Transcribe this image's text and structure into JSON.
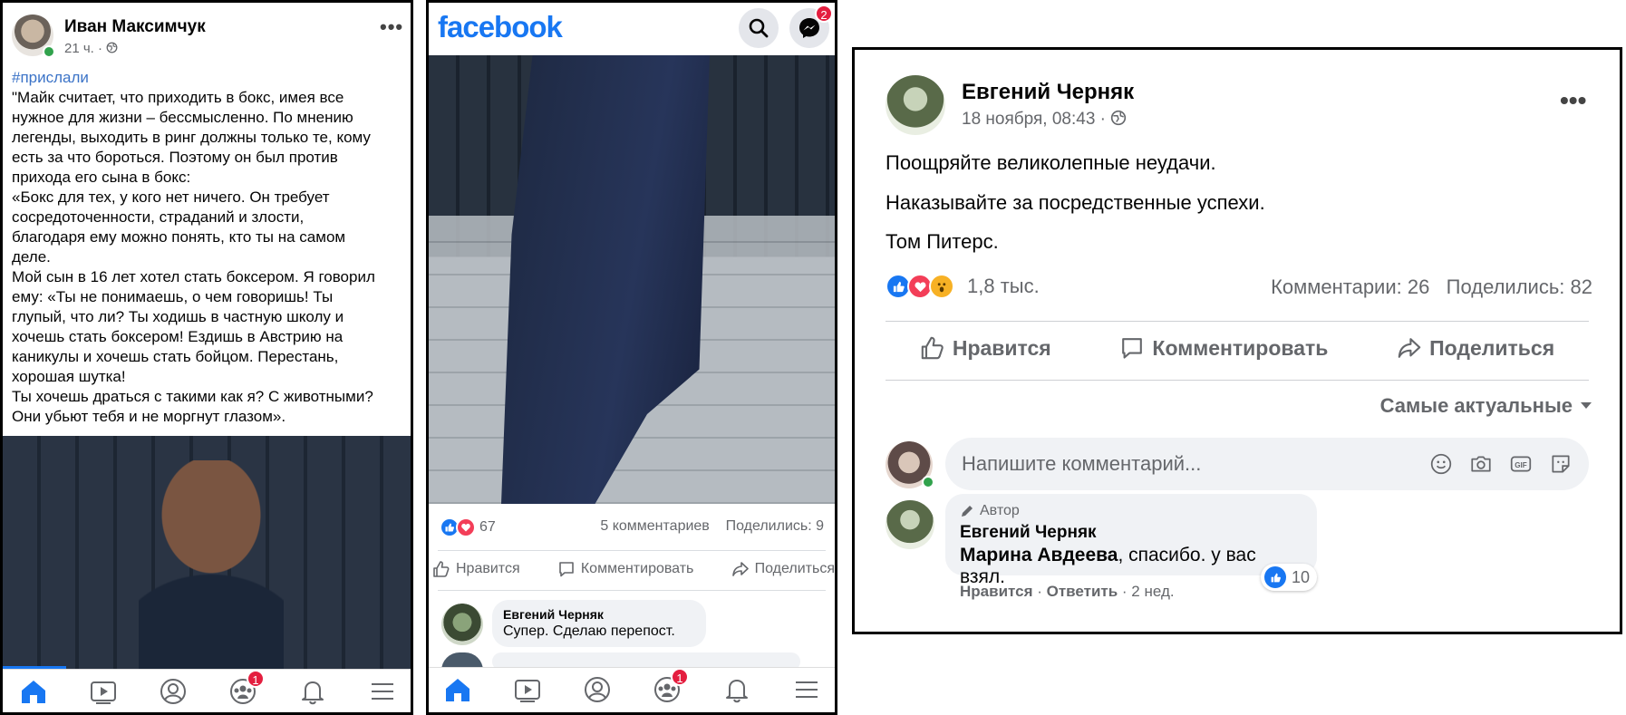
{
  "panel1": {
    "author": "Иван Максимчук",
    "time": "21 ч. ·",
    "more": "•••",
    "hashtag": "#прислали",
    "text": "\"Майк считает, что приходить в бокс, имея все\nнужное для жизни – бессмысленно. По мнению\nлегенды, выходить в ринг должны только те, кому\nесть за что бороться. Поэтому он был против\nприхода его сына в бокс:\n«Бокс для тех, у кого нет ничего. Он требует\nсосредоточенности, страданий и злости,\nблагодаря ему можно понять, кто ты на самом\nделе.\nМой сын в 16 лет хотел стать боксером. Я говорил\nему: «Ты не понимаешь, о чем говоришь! Ты\nглупый, что ли? Ты ходишь в частную школу и\nхочешь стать боксером! Ездишь в Австрию на\nканикулы и хочешь стать бойцом. Перестань,\nхорошая шутка!\nТы хочешь драться с такими как я? С животными?\nОни убьют тебя и не моргнут глазом».",
    "groups_badge": "1"
  },
  "panel2": {
    "logo": "facebook",
    "messenger_badge": "2",
    "reaction_count": "67",
    "comments": "5 комментариев",
    "shares": "Поделились: 9",
    "actions": {
      "like": "Нравится",
      "comment": "Комментировать",
      "share": "Поделиться"
    },
    "comment": {
      "author": "Евгений Черняк",
      "text": "Супер. Сделаю перепост."
    },
    "groups_badge": "1"
  },
  "panel3": {
    "author": "Евгений Черняк",
    "date": "18 ноября, 08:43 ·",
    "more": "•••",
    "lines": [
      "Поощряйте великолепные неудачи.",
      "Наказывайте за посредственные успехи.",
      "Том Питерс."
    ],
    "reaction_count": "1,8 тыс.",
    "comments": "Комментарии: 26",
    "shares": "Поделились: 82",
    "actions": {
      "like": "Нравится",
      "comment": "Комментировать",
      "share": "Поделиться"
    },
    "sort": "Самые актуальные",
    "input_placeholder": "Напишите комментарий...",
    "reply": {
      "badge": "Автор",
      "author": "Евгений Черняк",
      "mention": "Марина Авдеева",
      "text": ", спасибо. у вас взял.",
      "likes": "10",
      "like_label": "Нравится",
      "reply_label": "Ответить",
      "age": "· 2 нед."
    }
  }
}
